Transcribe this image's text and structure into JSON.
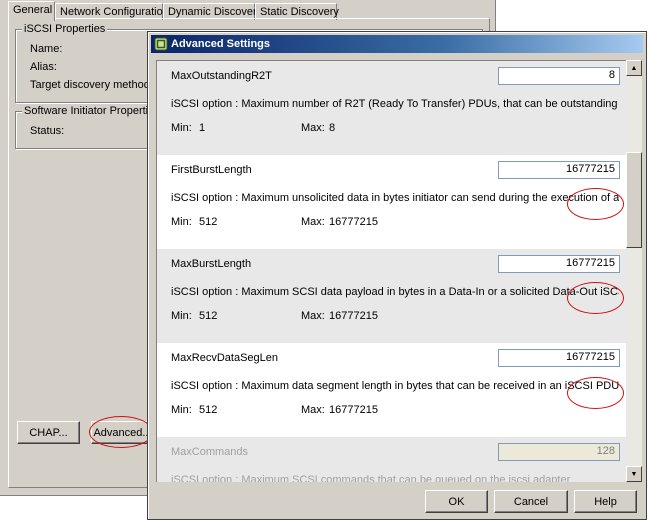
{
  "background_window": {
    "tabs": [
      "General",
      "Network Configuration",
      "Dynamic Discovery",
      "Static Discovery"
    ],
    "iscsi_properties": {
      "title": "iSCSI Properties",
      "name_label": "Name:",
      "alias_label": "Alias:",
      "discovery_label": "Target discovery methods:"
    },
    "software_initiator": {
      "title": "Software Initiator Properties",
      "status_label": "Status:"
    },
    "chap_button": "CHAP...",
    "advanced_button": "Advanced..."
  },
  "dialog": {
    "title": "Advanced Settings",
    "settings": [
      {
        "name": "MaxOutstandingR2T",
        "value": "8",
        "description": "iSCSI option : Maximum number of R2T (Ready To Transfer) PDUs, that can be outstanding for a ta...",
        "min_label": "Min:",
        "min": "1",
        "max_label": "Max:",
        "max": "8"
      },
      {
        "name": "FirstBurstLength",
        "value": "16777215",
        "description": "iSCSI option : Maximum unsolicited data in bytes initiator can send during the execution of a single ...",
        "min_label": "Min:",
        "min": "512",
        "max_label": "Max:",
        "max": "16777215"
      },
      {
        "name": "MaxBurstLength",
        "value": "16777215",
        "description": "iSCSI option : Maximum SCSI data payload in bytes in a Data-In or a solicited Data-Out iSCSI sequ...",
        "min_label": "Min:",
        "min": "512",
        "max_label": "Max:",
        "max": "16777215"
      },
      {
        "name": "MaxRecvDataSegLen",
        "value": "16777215",
        "description": "iSCSI option : Maximum data segment length in bytes that can be received in an iSCSI PDU.",
        "min_label": "Min:",
        "min": "512",
        "max_label": "Max:",
        "max": "16777215"
      },
      {
        "name": "MaxCommands",
        "value": "128",
        "description": "iSCSI option : Maximum SCSI commands that can be queued on the iscsi adapter",
        "min_label": "",
        "min": "",
        "max_label": "",
        "max": ""
      }
    ],
    "ok_button": "OK",
    "cancel_button": "Cancel",
    "help_button": "Help"
  },
  "colors": {
    "highlight_oval": "#d01010",
    "titlebar": "#0a246a",
    "row_alt": "#e8e8e8"
  }
}
